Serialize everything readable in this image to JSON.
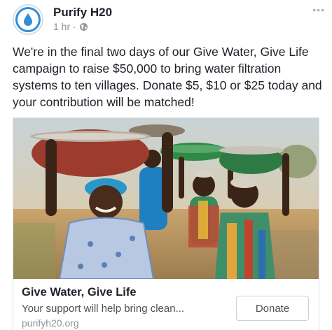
{
  "post": {
    "page_name": "Purify H20",
    "time": "1 hr",
    "separator": "·",
    "audience_icon": "globe-icon",
    "more_icon": "more-options-icon",
    "body": "We're in the final two days of our Give Water, Give Life campaign to raise $50,000 to bring water filtration systems to ten villages. Donate $5, $10 or $25 today and your contribution will be matched!"
  },
  "link_card": {
    "title": "Give Water, Give Life",
    "description": "Your support will help bring clean...",
    "domain": "purifyh20.org",
    "cta_label": "Donate"
  },
  "colors": {
    "brand_blue": "#2f8ed6",
    "text_primary": "#1d2129",
    "text_secondary": "#90949c",
    "border": "#dddfe2"
  }
}
